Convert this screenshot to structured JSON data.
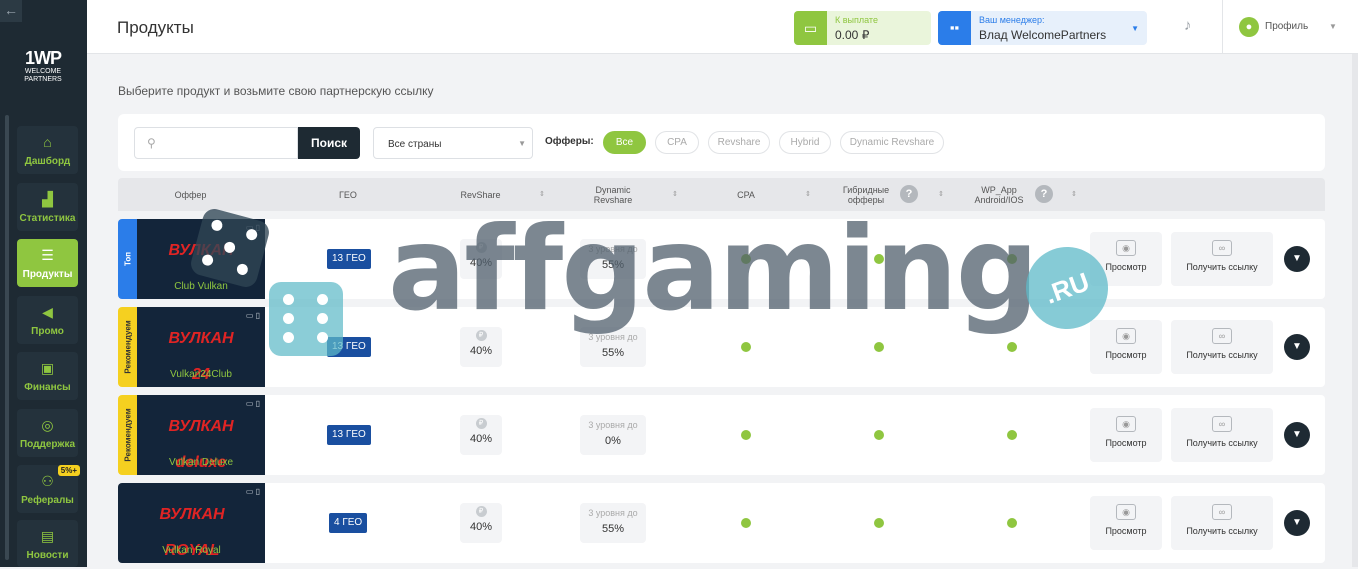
{
  "sidebar": {
    "collapse_icon": "arrow-left-icon",
    "logo": {
      "mark": "1WP",
      "line1": "WELCOME",
      "line2": "PARTNERS"
    },
    "items": [
      {
        "label": "Дашборд",
        "icon": "home-icon",
        "active": false
      },
      {
        "label": "Статистика",
        "icon": "chart-icon",
        "active": false
      },
      {
        "label": "Продукты",
        "icon": "list-icon",
        "active": true
      },
      {
        "label": "Промо",
        "icon": "megaphone-icon",
        "active": false
      },
      {
        "label": "Финансы",
        "icon": "money-icon",
        "active": false
      },
      {
        "label": "Поддержка",
        "icon": "lifebuoy-icon",
        "active": false
      },
      {
        "label": "Рефералы",
        "icon": "referral-icon",
        "active": false,
        "badge": "5%+"
      },
      {
        "label": "Новости",
        "icon": "news-icon",
        "active": false
      }
    ]
  },
  "header": {
    "title": "Продукты",
    "payout": {
      "label": "К выплате",
      "value": "0.00 ₽"
    },
    "manager": {
      "label": "Ваш менеджер:",
      "value": "Влад WelcomePartners"
    },
    "profile": {
      "label": "Профиль"
    }
  },
  "subtitle": "Выберите продукт и возьмите свою партнерскую ссылку",
  "filters": {
    "search_placeholder": "",
    "search_button": "Поиск",
    "country_select": "Все страны",
    "offers_label": "Офферы:",
    "chips": [
      "Все",
      "CPA",
      "Revshare",
      "Hybrid",
      "Dynamic Revshare"
    ],
    "active_chip": "Все"
  },
  "table": {
    "headers": {
      "offer": "Оффер",
      "geo": "ГЕО",
      "revshare": "RevShare",
      "dynamic": "Dynamic Revshare",
      "cpa": "CPA",
      "hybrid": "Гибридные офферы",
      "wp_app": "WP_App Android/IOS"
    },
    "rows": [
      {
        "ribbon": "Топ",
        "ribbon_color": "#2b7de9",
        "brand": "ВУЛКАН",
        "name": "Club Vulkan",
        "geo": "13 ГЕО",
        "revshare": "40%",
        "dynamic_label": "3 уровня до",
        "dynamic": "55%",
        "cpa": true,
        "hybrid": true,
        "wp_app": true
      },
      {
        "ribbon": "Рекомендуем",
        "ribbon_color": "#f5d020",
        "brand": "ВУЛКАН 24",
        "name": "Vulkan24Club",
        "geo": "13 ГЕО",
        "revshare": "40%",
        "dynamic_label": "3 уровня до",
        "dynamic": "55%",
        "cpa": true,
        "hybrid": true,
        "wp_app": true
      },
      {
        "ribbon": "Рекомендуем",
        "ribbon_color": "#f5d020",
        "brand": "ВУЛКАН deluxe",
        "name": "Vulkan Deluxe",
        "geo": "13 ГЕО",
        "revshare": "40%",
        "dynamic_label": "3 уровня до",
        "dynamic": "0%",
        "cpa": true,
        "hybrid": true,
        "wp_app": true
      },
      {
        "ribbon": "",
        "ribbon_color": "",
        "brand": "ВУЛКАН ROYAL",
        "name": "Vulkan Royal",
        "geo": "4 ГЕО",
        "revshare": "40%",
        "dynamic_label": "3 уровня до",
        "dynamic": "55%",
        "cpa": true,
        "hybrid": true,
        "wp_app": true
      }
    ],
    "actions": {
      "view": "Просмотр",
      "link": "Получить ссылку"
    }
  },
  "watermark": {
    "text": "affgaming",
    "badge": ".RU"
  }
}
